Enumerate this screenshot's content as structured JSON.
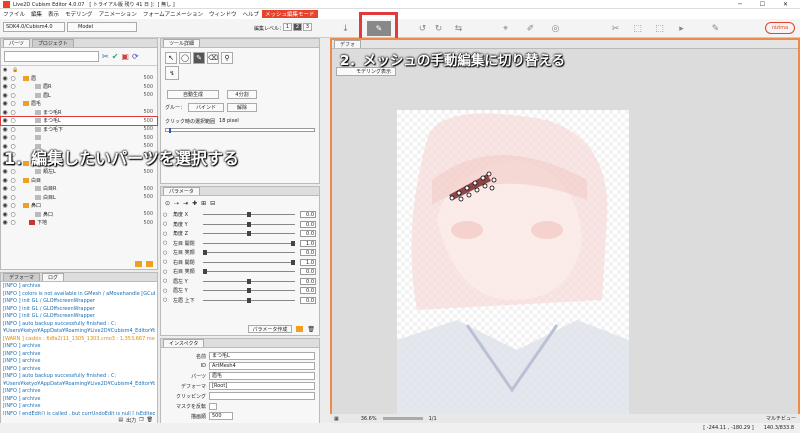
{
  "app": {
    "title": "Live2D Cubism Editor 4.0.07　[ トライアル版 残り 41 日 ]：[ 無し ]"
  },
  "menu": [
    "ファイル",
    "編集",
    "表示",
    "モデリング",
    "アニメーション",
    "フォームアニメーション",
    "ウィンドウ",
    "ヘルプ"
  ],
  "mode_badge": "メッシュ編集モード",
  "toolbar": {
    "edit_level_label": "編集レベル：",
    "levels": [
      "1",
      "2",
      "3"
    ],
    "brand": "nizima"
  },
  "sdk_select": "SDK4.0/Cubism4.0",
  "model_select": "Model",
  "parts_panel": {
    "tabs": [
      "パーツ",
      "プロジェクト"
    ],
    "rows": [
      {
        "label": "眉",
        "value": "500",
        "indent": 1
      },
      {
        "label": "眉R",
        "value": "500",
        "indent": 3
      },
      {
        "label": "眉L",
        "value": "500",
        "indent": 3
      },
      {
        "label": "眉毛",
        "value": "",
        "indent": 1
      },
      {
        "label": "まつ毛R",
        "value": "500",
        "indent": 3
      },
      {
        "label": "まつ毛L",
        "value": "500",
        "indent": 3
      },
      {
        "label": "まつ毛下",
        "value": "500",
        "indent": 3
      },
      {
        "label": "",
        "value": "500",
        "indent": 3
      },
      {
        "label": "",
        "value": "500",
        "indent": 3
      },
      {
        "label": "",
        "value": "500",
        "indent": 3
      },
      {
        "label": "頬",
        "value": "",
        "indent": 1
      },
      {
        "label": "頬左L",
        "value": "500",
        "indent": 3
      },
      {
        "label": "白目",
        "value": "",
        "indent": 1
      },
      {
        "label": "白目R",
        "value": "500",
        "indent": 3
      },
      {
        "label": "白目L",
        "value": "500",
        "indent": 3
      },
      {
        "label": "鼻口",
        "value": "",
        "indent": 1
      },
      {
        "label": "鼻口",
        "value": "500",
        "indent": 3
      },
      {
        "label": "下地",
        "value": "500",
        "indent": 2
      }
    ]
  },
  "log_panel": {
    "tabs": [
      "デフォーマ",
      "ログ"
    ],
    "lines": [
      "[INFO ] archive",
      "[INFO ] colors is not available in GMesh / aMovehandle [GCube",
      "[INFO ] init GL / GLOffscreenWrapper",
      "[INFO ] init GL / GLOffscreenWrapper",
      "[INFO ] init GL / GLOffscreenWrapper",
      "[INFO ] auto backup successfully finished : C:",
      "¥Users¥ketyo¥AppData¥Roaming¥Live2D¥Cubism4_Editor¥bac",
      "[WARN ] casbin : 6dfa2(11_1305_1303.cmo3 : 1,353,667 msec",
      "[INFO ] archive",
      "[INFO ] archive",
      "[INFO ] archive",
      "[INFO ] archive",
      "[INFO ] auto backup successfully finished : C:",
      "¥Users¥ketyo¥AppData¥Roaming¥Live2D¥Cubism4_Editor¥bac",
      "[INFO ] archive",
      "[INFO ] archive",
      "[INFO ] archive",
      "[INFO ] endEdit() is called , but currUndoEdit is null [ isEdited =",
      "[INFO ] colors is not available in GMesh / [眉R] @CArtMesh",
      "[INFO ] archive"
    ],
    "footer": [
      "出力"
    ]
  },
  "tool_panel": {
    "title": "ツール詳細",
    "auto_mesh": "自動生成",
    "split_4": "4分割",
    "glue": "グルー：",
    "bind": "バインド",
    "release": "解除",
    "click_range_label": "クリック時の選択範囲",
    "click_range_value": "18 pixel"
  },
  "param_panel": {
    "title": "パラメータ",
    "create_btn": "パラメータ作成",
    "params": [
      {
        "label": "角度 X",
        "value": "0.0",
        "pos": 0.5
      },
      {
        "label": "角度 Y",
        "value": "0.0",
        "pos": 0.5
      },
      {
        "label": "角度 Z",
        "value": "0.0",
        "pos": 0.5
      },
      {
        "label": "左目 開閉",
        "value": "1.0",
        "pos": 1.0
      },
      {
        "label": "左目 笑顔",
        "value": "0.0",
        "pos": 0.0
      },
      {
        "label": "右目 開閉",
        "value": "1.0",
        "pos": 1.0
      },
      {
        "label": "右目 笑顔",
        "value": "0.0",
        "pos": 0.0
      },
      {
        "label": "眉左 Y",
        "value": "0.0",
        "pos": 0.5
      },
      {
        "label": "眉左 Y",
        "value": "0.0",
        "pos": 0.5
      },
      {
        "label": "左眉 上下",
        "value": "0.0",
        "pos": 0.5
      }
    ]
  },
  "inspector": {
    "title": "インスペクタ",
    "rows": [
      {
        "label": "名前",
        "value": "まつ毛L"
      },
      {
        "label": "ID",
        "value": "ArtMesh4"
      },
      {
        "label": "パーツ",
        "value": "眉毛"
      },
      {
        "label": "デフォーマ",
        "value": "[Root]"
      },
      {
        "label": "クリッピング",
        "value": ""
      },
      {
        "label": "マスクを反転",
        "value": ""
      },
      {
        "label": "描画順",
        "value": "500"
      }
    ]
  },
  "viewport": {
    "tab": "デフォ",
    "mode_select": "モデリング表示",
    "zoom": "36.6%",
    "ratio": "1/1",
    "color_mode": "マルチビュー"
  },
  "status": {
    "coords": "[ -244.11 , -180.29 ]",
    "zoom_detail": "140.3/833.8"
  },
  "annotations": {
    "step1": "1．編集したいパーツを選択する",
    "step2": "2．メッシュの手動編集に切り替える"
  },
  "colors": {
    "accent": "#e8422c",
    "highlight": "#e23a3a",
    "viewport_border": "#f08a4b"
  }
}
